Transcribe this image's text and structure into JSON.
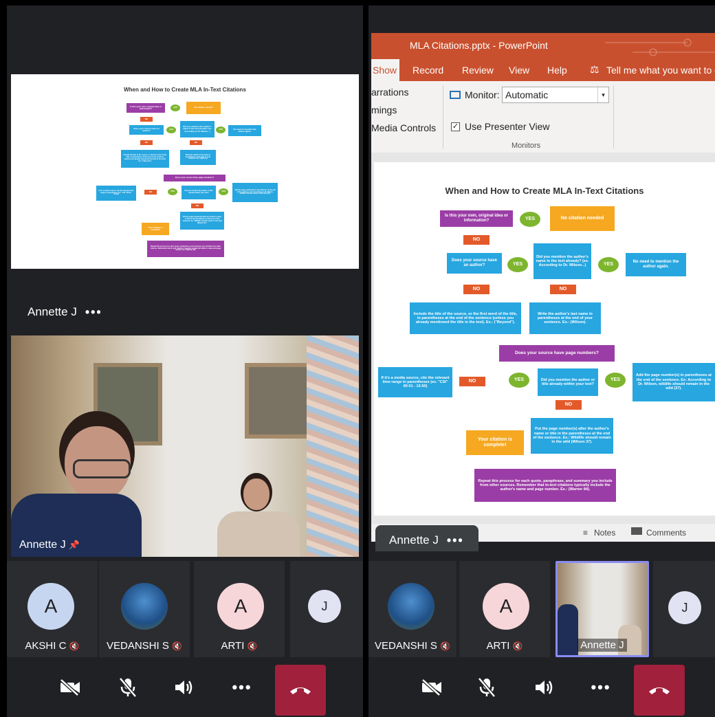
{
  "colors": {
    "bg": "#202124",
    "tile": "#2b2c30",
    "hangup": "#a1203c",
    "ppt_accent": "#c9502e"
  },
  "flowchart": {
    "title": "When and How to Create MLA In-Text Citations",
    "yes": "YES",
    "no": "NO",
    "q_own": "Is this your own, original idea or information?",
    "no_citation": "No citation needed",
    "q_author": "Does your source have an author?",
    "q_mention": "Did you mention the author's name in the text already? (ex. According to Dr. Wilson...)",
    "no_need": "No need to mention the author again.",
    "include_title": "Include the title of the source, or the first word of the title, in parentheses at the end of the sentence (unless you already mentioned the title in the text). Ex.: (\"Beyond\").",
    "write_last": "Write the author's last name in parentheses at the end of your sentence. Ex.: (Wilson).",
    "q_pages": "Does your source have page numbers?",
    "media": "If it's a media source, cite the relevant time range in parentheses (ex. \"CSI\" 00:01 - 15:50)",
    "q_mention_in_text": "Did you mention the author or title already within your text?",
    "add_pages": "Add the page number(s) in parentheses at the end of the sentence. Ex: According to Dr. Wilson, wildlife should remain in the wild (37).",
    "put_pages": "Put the page number(s) after the author's name or title in the parentheses at the end of the sentence. Ex.: Wildlife should remain in the wild (Wilson 37).",
    "complete": "Your citation is complete!",
    "repeat": "Repeat this process for each quote, paraphrase, and summary you include from other sources. Remember that in-text citations typically include the author's name and page number. Ex.: (Warner 84)."
  },
  "left": {
    "presenter_label": "Annette J",
    "video_label": "Annette J",
    "thumbs": [
      {
        "initial": "A",
        "name": "AKSHI C"
      },
      {
        "initial": "",
        "name": "VEDANSHI S"
      },
      {
        "initial": "A",
        "name": "ARTI"
      },
      {
        "initial": "J",
        "name": ""
      }
    ]
  },
  "right": {
    "ppt": {
      "title": "MLA Citations.pptx  -  PowerPoint",
      "tabs": [
        "Show",
        "Record",
        "Review",
        "View",
        "Help"
      ],
      "tell_me": "Tell me what you want to d",
      "ribbon_left": [
        "arrations",
        "mings",
        "Media Controls"
      ],
      "monitor_label": "Monitor:",
      "monitor_value": "Automatic",
      "presenter_view": "Use Presenter View",
      "group_label": "Monitors",
      "notes": "Notes",
      "comments": "Comments"
    },
    "presenter_label": "Annette J",
    "thumbs": [
      {
        "initial": "",
        "name": "VEDANSHI S"
      },
      {
        "initial": "A",
        "name": "ARTI"
      },
      {
        "initial": "",
        "name": "Annette J"
      },
      {
        "initial": "J",
        "name": ""
      }
    ]
  }
}
